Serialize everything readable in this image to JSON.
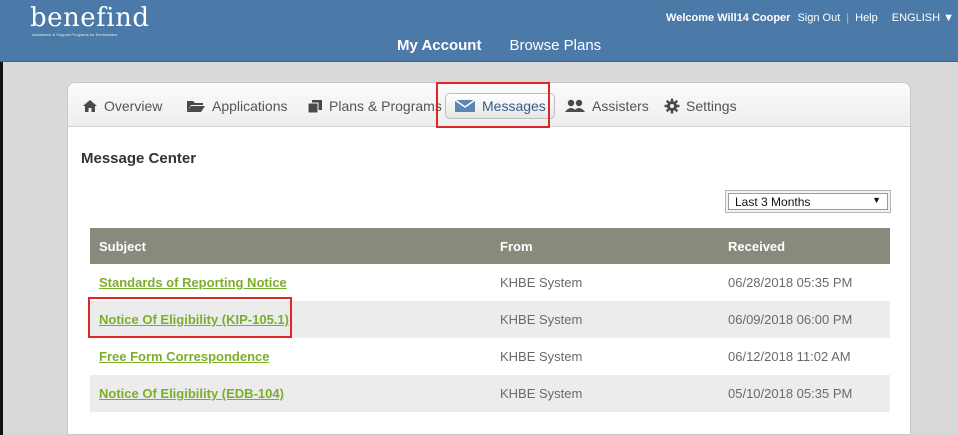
{
  "header": {
    "logo_text": "benefind",
    "logo_tagline": "Assistance & Support Programs for Kentuckians",
    "welcome": "Welcome Will14 Cooper",
    "sign_out": "Sign Out",
    "separator": "|",
    "help": "Help",
    "language": "ENGLISH ▼",
    "nav": [
      "My Account",
      "Browse Plans"
    ]
  },
  "tabs": [
    {
      "label": "Overview",
      "icon": "home-icon"
    },
    {
      "label": "Applications",
      "icon": "folder-icon"
    },
    {
      "label": "Plans & Programs",
      "icon": "copy-icon"
    },
    {
      "label": "Messages",
      "icon": "envelope-icon"
    },
    {
      "label": "Assisters",
      "icon": "users-icon"
    },
    {
      "label": "Settings",
      "icon": "gear-icon"
    }
  ],
  "page_title": "Message Center",
  "filter": {
    "selected": "Last 3 Months"
  },
  "table": {
    "headers": [
      "Subject",
      "From",
      "Received"
    ],
    "rows": [
      {
        "subject": "Standards of Reporting Notice",
        "from": "KHBE System",
        "received": "06/28/2018 05:35 PM"
      },
      {
        "subject": "Notice Of Eligibility (KIP-105.1)",
        "from": "KHBE System",
        "received": "06/09/2018 06:00 PM"
      },
      {
        "subject": "Free Form Correspondence",
        "from": "KHBE System",
        "received": "06/12/2018 11:02 AM"
      },
      {
        "subject": "Notice Of Eligibility (EDB-104)",
        "from": "KHBE System",
        "received": "05/10/2018 05:35 PM"
      }
    ]
  },
  "colors": {
    "header_bg": "#4b79a8",
    "table_header_bg": "#8a8a7c",
    "link_green": "#7cae2b",
    "highlight_red": "#e0252b"
  }
}
